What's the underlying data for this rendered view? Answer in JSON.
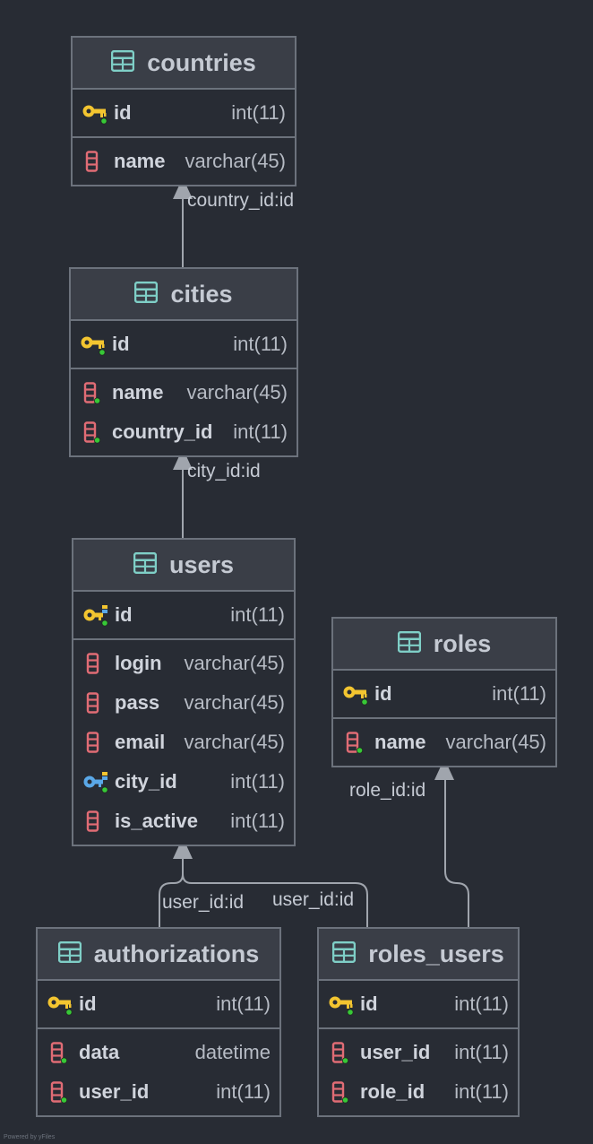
{
  "tables": {
    "countries": {
      "title": "countries",
      "pk": [
        {
          "name": "id",
          "type": "int(11)"
        }
      ],
      "cols": [
        {
          "name": "name",
          "type": "varchar(45)"
        }
      ]
    },
    "cities": {
      "title": "cities",
      "pk": [
        {
          "name": "id",
          "type": "int(11)"
        }
      ],
      "cols": [
        {
          "name": "name",
          "type": "varchar(45)"
        },
        {
          "name": "country_id",
          "type": "int(11)"
        }
      ]
    },
    "users": {
      "title": "users",
      "pk": [
        {
          "name": "id",
          "type": "int(11)"
        }
      ],
      "cols": [
        {
          "name": "login",
          "type": "varchar(45)"
        },
        {
          "name": "pass",
          "type": "varchar(45)"
        },
        {
          "name": "email",
          "type": "varchar(45)"
        },
        {
          "name": "city_id",
          "type": "int(11)"
        },
        {
          "name": "is_active",
          "type": "int(11)"
        }
      ]
    },
    "roles": {
      "title": "roles",
      "pk": [
        {
          "name": "id",
          "type": "int(11)"
        }
      ],
      "cols": [
        {
          "name": "name",
          "type": "varchar(45)"
        }
      ]
    },
    "authorizations": {
      "title": "authorizations",
      "pk": [
        {
          "name": "id",
          "type": "int(11)"
        }
      ],
      "cols": [
        {
          "name": "data",
          "type": "datetime"
        },
        {
          "name": "user_id",
          "type": "int(11)"
        }
      ]
    },
    "roles_users": {
      "title": "roles_users",
      "pk": [
        {
          "name": "id",
          "type": "int(11)"
        }
      ],
      "cols": [
        {
          "name": "user_id",
          "type": "int(11)"
        },
        {
          "name": "role_id",
          "type": "int(11)"
        }
      ]
    }
  },
  "relations": {
    "cities_countries": "country_id:id",
    "users_cities": "city_id:id",
    "authorizations_users": "user_id:id",
    "roles_users_users": "user_id:id",
    "roles_users_roles": "role_id:id"
  },
  "footer": "Powered by yFiles",
  "colors": {
    "background": "#282c34",
    "header": "#3a3e47",
    "border": "#6c727c",
    "pk_key": "#f3c530",
    "fk_key": "#5aa8e8",
    "column_icon": "#e06c75",
    "table_icon": "#7fcfc7",
    "not_null_dot": "#37c837"
  }
}
